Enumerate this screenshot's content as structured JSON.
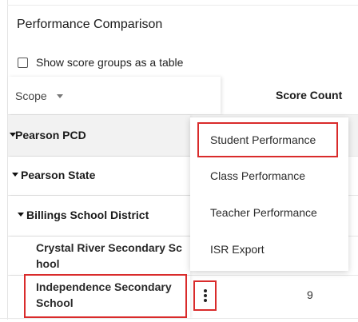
{
  "panel": {
    "title": "Performance Comparison",
    "show_table_label": "Show score groups as a table"
  },
  "table": {
    "headers": {
      "scope": "Scope",
      "score_count": "Score Count"
    },
    "rows": [
      {
        "label": "Pearson PCD",
        "level": 0
      },
      {
        "label": "Pearson State",
        "level": 1
      },
      {
        "label": "Billings School District",
        "level": 2
      },
      {
        "label_line1": "Crystal River Secondary Sc",
        "label_line2": "hool",
        "level": 3
      },
      {
        "label_line1": "Independence Secondary",
        "label_line2": "School",
        "level": 3,
        "score_count": "9"
      }
    ]
  },
  "menu": {
    "items": [
      "Student Performance",
      "Class Performance",
      "Teacher Performance",
      "ISR Export"
    ]
  },
  "colors": {
    "highlight": "#d92b2b",
    "row_selected_bg": "#f2f2f2"
  },
  "icons": {
    "sort": "chevron-down-icon",
    "expand": "caret-down-icon",
    "more": "kebab-icon"
  }
}
